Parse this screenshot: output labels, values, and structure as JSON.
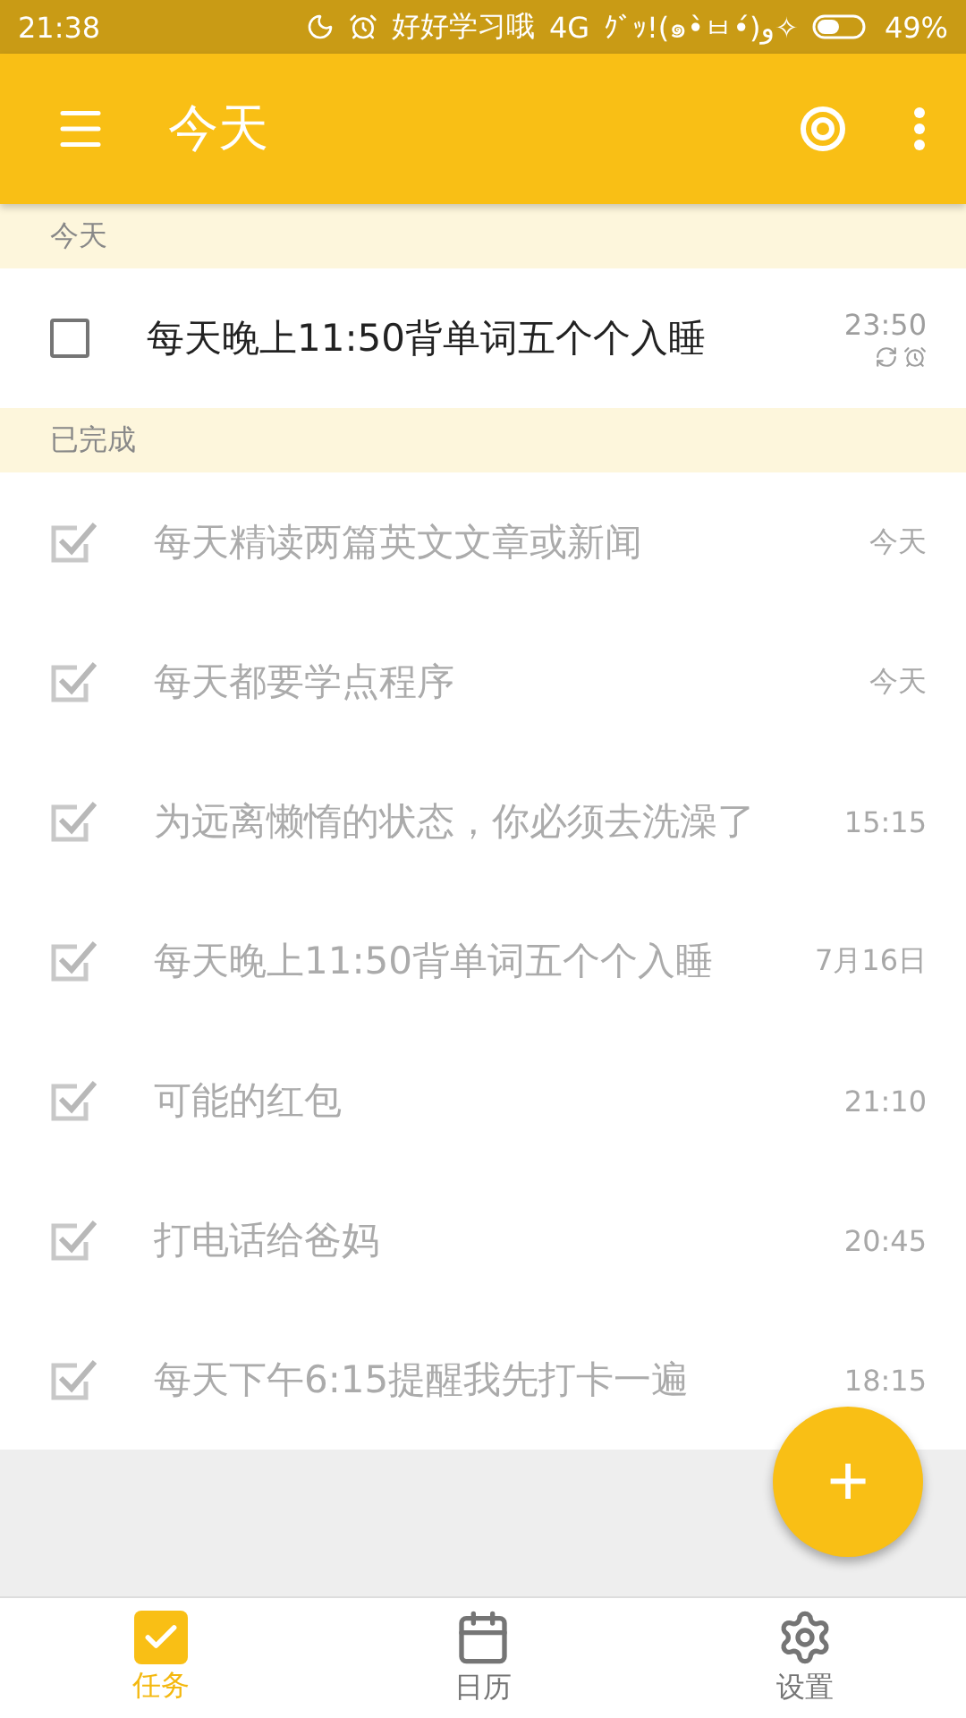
{
  "status_bar": {
    "time": "21:38",
    "carrier": "好好学习哦",
    "network": "4G",
    "extra": "ｸﾞｯ!(๑•̀ㅂ•́)و✧",
    "battery": "49%"
  },
  "app_bar": {
    "title": "今天"
  },
  "sections": [
    {
      "title": "今天",
      "tasks": [
        {
          "text": "每天晚上11:50背单词五个个入睡",
          "checked": false,
          "time": "23:50",
          "repeat": true,
          "alarm": true
        }
      ]
    },
    {
      "title": "已完成",
      "tasks": [
        {
          "text": "每天精读两篇英文文章或新闻",
          "checked": true,
          "time": "今天",
          "repeat": false,
          "alarm": false
        },
        {
          "text": "每天都要学点程序",
          "checked": true,
          "time": "今天",
          "repeat": false,
          "alarm": false
        },
        {
          "text": "为远离懒惰的状态，你必须去洗澡了",
          "checked": true,
          "time": "15:15",
          "repeat": false,
          "alarm": false
        },
        {
          "text": "每天晚上11:50背单词五个个入睡",
          "checked": true,
          "time": "7月16日",
          "repeat": false,
          "alarm": false
        },
        {
          "text": "可能的红包",
          "checked": true,
          "time": "21:10",
          "repeat": false,
          "alarm": false
        },
        {
          "text": "打电话给爸妈",
          "checked": true,
          "time": "20:45",
          "repeat": false,
          "alarm": false
        },
        {
          "text": "每天下午6:15提醒我先打卡一遍",
          "checked": true,
          "time": "18:15",
          "repeat": false,
          "alarm": false
        }
      ]
    }
  ],
  "fab": {
    "label": "+"
  },
  "bottom_nav": [
    {
      "kind": "tasks",
      "label": "任务",
      "selected": true
    },
    {
      "kind": "calendar",
      "label": "日历",
      "selected": false
    },
    {
      "kind": "settings",
      "label": "设置",
      "selected": false
    }
  ]
}
